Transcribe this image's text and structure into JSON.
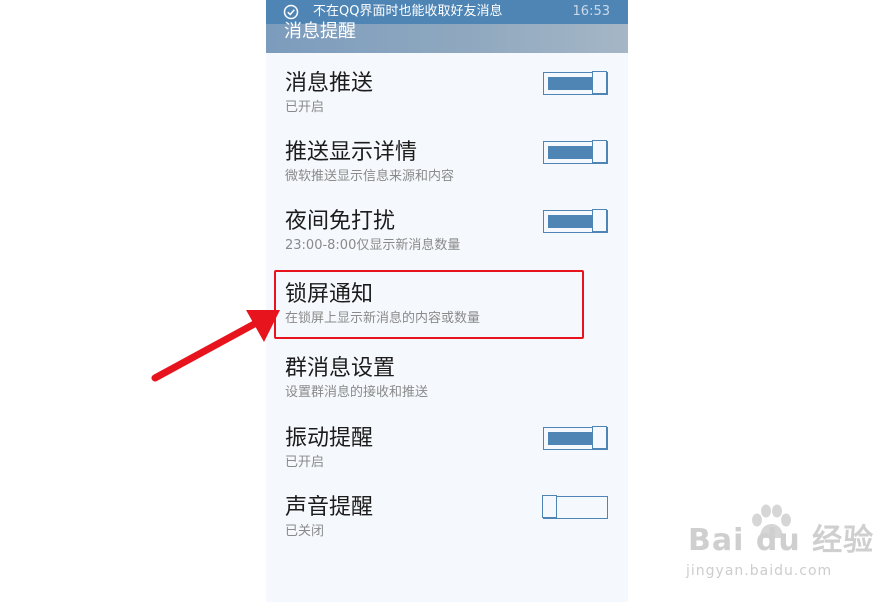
{
  "status_bar": {
    "notice": "不在QQ界面时也能收取好友消息",
    "time": "16:53",
    "icon": "check-circle-icon"
  },
  "header": {
    "title": "消息提醒"
  },
  "settings": [
    {
      "title": "消息推送",
      "subtitle": "已开启",
      "toggle": true
    },
    {
      "title": "推送显示详情",
      "subtitle": "微软推送显示信息来源和内容",
      "toggle": true
    },
    {
      "title": "夜间免打扰",
      "subtitle": "23:00-8:00仅显示新消息数量",
      "toggle": true
    },
    {
      "title": "锁屏通知",
      "subtitle": "在锁屏上显示新消息的内容或数量",
      "toggle": null
    },
    {
      "title": "群消息设置",
      "subtitle": "设置群消息的接收和推送",
      "toggle": null
    },
    {
      "title": "振动提醒",
      "subtitle": "已开启",
      "toggle": true
    },
    {
      "title": "声音提醒",
      "subtitle": "已关闭",
      "toggle": false
    }
  ],
  "annotation": {
    "highlighted_item": "锁屏通知",
    "highlight_color": "#e8141d",
    "arrow_color": "#e8141d"
  },
  "watermark": {
    "brand": "Bai du 经验",
    "url": "jingyan.baidu.com"
  },
  "colors": {
    "accent": "#4f85b5",
    "background": "#f5f8fc"
  }
}
